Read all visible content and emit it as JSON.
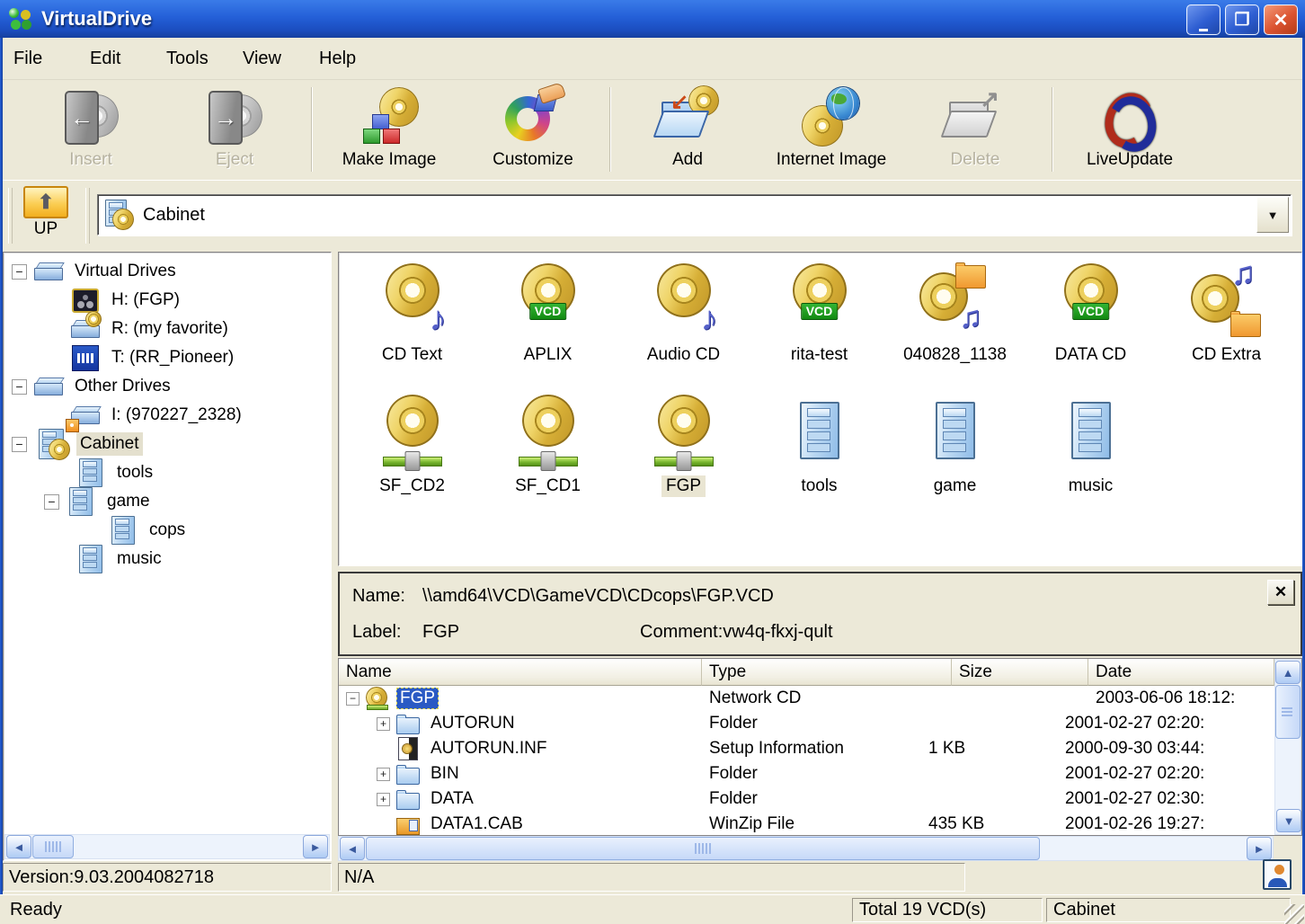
{
  "titlebar": {
    "title": "VirtualDrive"
  },
  "menu": {
    "items": [
      "File",
      "Edit",
      "Tools",
      "View",
      "Help"
    ]
  },
  "toolbar": {
    "buttons": [
      {
        "label": "Insert",
        "disabled": true
      },
      {
        "label": "Eject",
        "disabled": true
      },
      {
        "label": "Make Image",
        "disabled": false
      },
      {
        "label": "Customize",
        "disabled": false
      },
      {
        "label": "Add",
        "disabled": false
      },
      {
        "label": "Internet Image",
        "disabled": false
      },
      {
        "label": "Delete",
        "disabled": true
      },
      {
        "label": "LiveUpdate",
        "disabled": false
      }
    ]
  },
  "addressbar": {
    "up_label": "UP",
    "location": "Cabinet"
  },
  "tree": {
    "items": [
      {
        "label": "Virtual Drives"
      },
      {
        "label": "H: (FGP)"
      },
      {
        "label": "R: (my favorite)"
      },
      {
        "label": "T: (RR_Pioneer)"
      },
      {
        "label": "Other Drives"
      },
      {
        "label": "I: (970227_2328)"
      },
      {
        "label": "Cabinet"
      },
      {
        "label": "tools"
      },
      {
        "label": "game"
      },
      {
        "label": "cops"
      },
      {
        "label": "music"
      }
    ]
  },
  "icon_grid": {
    "badge": "VCD",
    "row1": [
      {
        "label": "CD Text"
      },
      {
        "label": "APLIX"
      },
      {
        "label": "Audio CD"
      },
      {
        "label": "rita-test"
      },
      {
        "label": "040828_1138"
      },
      {
        "label": "DATA CD"
      },
      {
        "label": "CD Extra"
      }
    ],
    "row2": [
      {
        "label": "SF_CD2"
      },
      {
        "label": "SF_CD1"
      },
      {
        "label": "FGP"
      },
      {
        "label": "tools"
      },
      {
        "label": "game"
      },
      {
        "label": "music"
      }
    ]
  },
  "details": {
    "name_label": "Name:",
    "name_value": "\\\\amd64\\VCD\\GameVCD\\CDcops\\FGP.VCD",
    "label_label": "Label:",
    "label_value": "FGP",
    "comment": "Comment:vw4q-fkxj-qult"
  },
  "table": {
    "columns": [
      "Name",
      "Type",
      "Size",
      "Date"
    ],
    "rows": [
      {
        "name": "FGP",
        "type": "Network CD",
        "size": "",
        "date": "2003-06-06 18:12:"
      },
      {
        "name": "AUTORUN",
        "type": "Folder",
        "size": "",
        "date": "2001-02-27 02:20:"
      },
      {
        "name": "AUTORUN.INF",
        "type": "Setup Information",
        "size": "1 KB",
        "date": "2000-09-30 03:44:"
      },
      {
        "name": "BIN",
        "type": "Folder",
        "size": "",
        "date": "2001-02-27 02:20:"
      },
      {
        "name": "DATA",
        "type": "Folder",
        "size": "",
        "date": "2001-02-27 02:30:"
      },
      {
        "name": "DATA1.CAB",
        "type": "WinZip File",
        "size": "435 KB",
        "date": "2001-02-26 19:27:"
      }
    ]
  },
  "status": {
    "version": "Version:9.03.2004082718",
    "na": "N/A",
    "ready": "Ready",
    "total": "Total 19 VCD(s)",
    "location": "Cabinet"
  }
}
